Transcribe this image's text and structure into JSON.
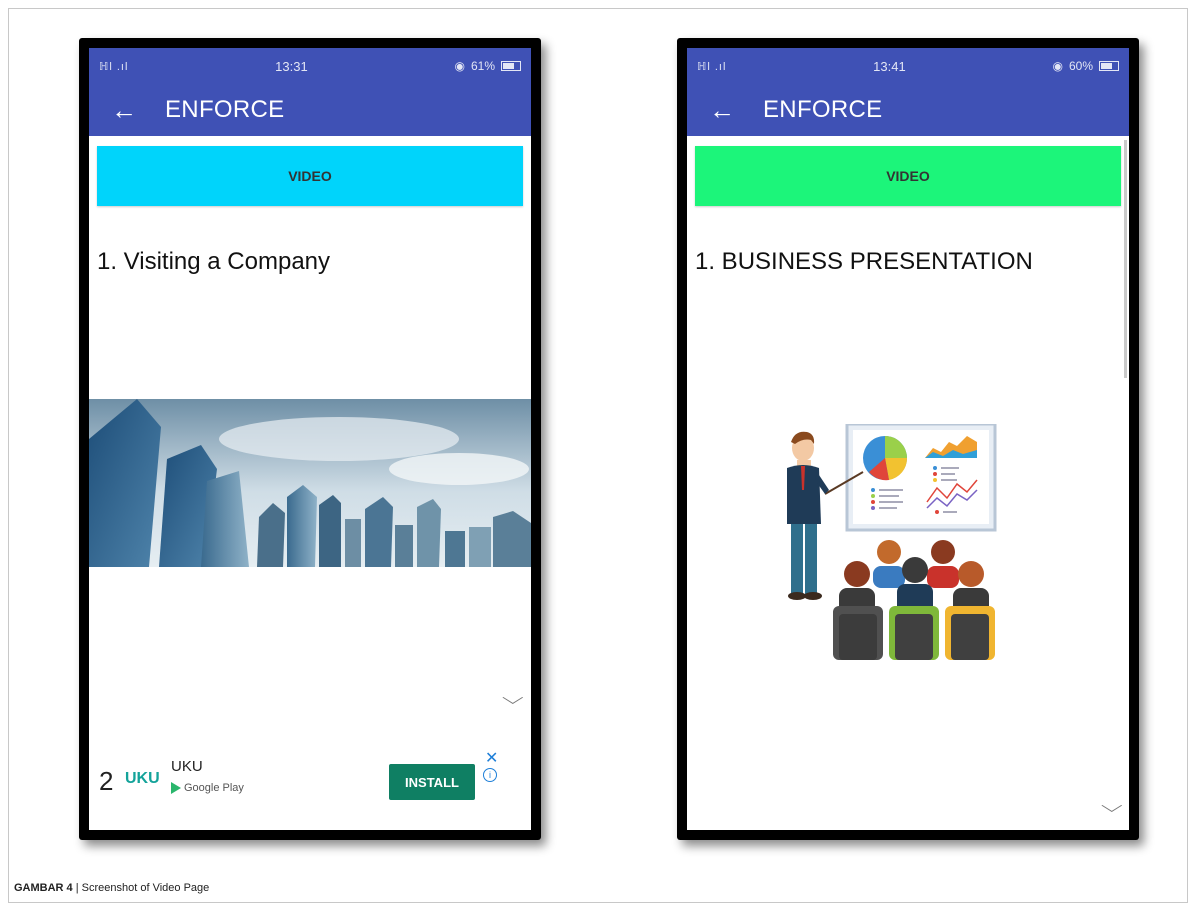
{
  "caption": {
    "label": "GAMBAR 4",
    "separator": " | ",
    "text": "Screenshot of Video Page"
  },
  "phone_left": {
    "status": {
      "signal": "ℍl .ıl",
      "time": "13:31",
      "battery": "61%"
    },
    "appbar": {
      "back_icon": "←",
      "title": "ENFORCE"
    },
    "video_button": {
      "label": "VIDEO",
      "color": "#00d4fb"
    },
    "item_title": "1. Visiting a Company",
    "chevron": "⌵",
    "ad": {
      "number": "2",
      "logo_text": "UKU",
      "app_name": "UKU",
      "store": "Google Play",
      "install_label": "INSTALL",
      "close_icon": "✕",
      "info_icon": "i"
    }
  },
  "phone_right": {
    "status": {
      "signal": "ℍl .ıl",
      "time": "13:41",
      "battery": "60%"
    },
    "appbar": {
      "back_icon": "←",
      "title": "ENFORCE"
    },
    "video_button": {
      "label": "VIDEO",
      "color": "#1cf57a"
    },
    "item_title": "1. BUSINESS PRESENTATION",
    "chevron": "⌵"
  }
}
